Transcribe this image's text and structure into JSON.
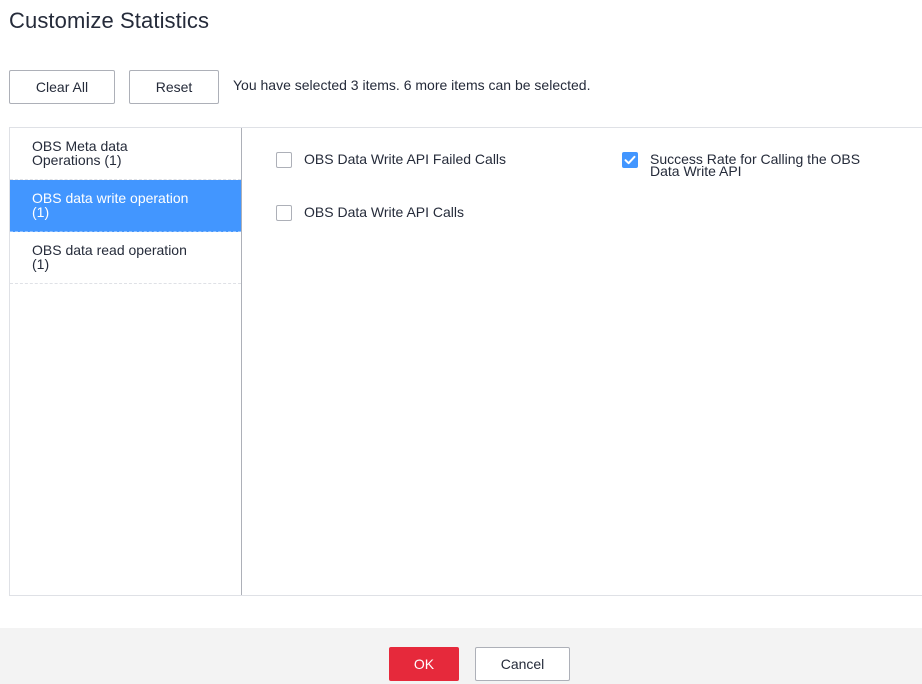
{
  "dialog": {
    "title": "Customize Statistics"
  },
  "toolbar": {
    "clear_all_label": "Clear All",
    "reset_label": "Reset",
    "selection_info": "You have selected 3 items. 6 more items can be selected."
  },
  "categories": [
    {
      "line1": "OBS Meta data",
      "line2": "Operations (1)",
      "active": false
    },
    {
      "line1": "OBS data write operation",
      "line2": "(1)",
      "active": true
    },
    {
      "line1": "OBS data read operation",
      "line2": "(1)",
      "active": false
    }
  ],
  "metrics": [
    {
      "line1": "OBS Data Write API Failed Calls",
      "checked": false
    },
    {
      "line1": "OBS Data Write API Calls",
      "checked": false
    },
    {
      "line1": "Success Rate for Calling the OBS",
      "line2": "Data Write API",
      "checked": true
    }
  ],
  "footer": {
    "ok_label": "OK",
    "cancel_label": "Cancel"
  },
  "colors": {
    "accent": "#4296ff",
    "primary_button": "#e6293b",
    "text": "#252b3a",
    "footer_bg": "#f3f3f3"
  },
  "icons": {
    "checkmark": "checkmark-icon"
  }
}
